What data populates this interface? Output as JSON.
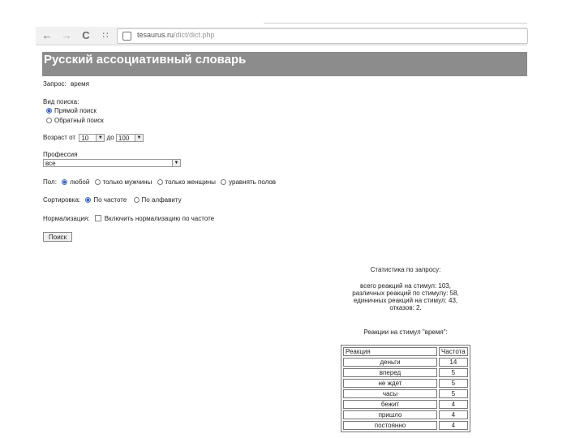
{
  "browser": {
    "url_host": "tesaurus.ru",
    "url_path": "/dict/dict.php",
    "icons": [
      "back-arrow-icon",
      "forward-arrow-icon",
      "reload-icon",
      "apps-icon",
      "page-info-icon"
    ]
  },
  "header": {
    "title": "Русский ассоциативный словарь"
  },
  "query": {
    "label": "Запрос:",
    "value": "время"
  },
  "search_type": {
    "label": "Вид поиска:",
    "options": [
      {
        "label": "Прямой поиск",
        "selected": true
      },
      {
        "label": "Обратный поиск",
        "selected": false
      }
    ]
  },
  "age": {
    "label_from": "Возраст от",
    "from_value": "10",
    "label_to": "до",
    "to_value": "100"
  },
  "profession": {
    "label": "Профессия",
    "value": "все"
  },
  "gender": {
    "label": "Пол:",
    "options": [
      {
        "label": "любой",
        "selected": true
      },
      {
        "label": "только мужчины",
        "selected": false
      },
      {
        "label": "только женщины",
        "selected": false
      },
      {
        "label": "уравнять полов",
        "selected": false
      }
    ]
  },
  "sorting": {
    "label": "Сортировка:",
    "options": [
      {
        "label": "По частоте",
        "selected": true
      },
      {
        "label": "По алфавиту",
        "selected": false
      }
    ]
  },
  "normalization": {
    "label": "Нормализация:",
    "checkbox_label": "Включить нормализацию по частоте",
    "checked": false
  },
  "search_button": "Поиск",
  "stats": {
    "title": "Статистика по запросу:",
    "lines": [
      "всего реакций на стимул: 103,",
      "различных реакций по стимулу: 58,",
      "единичных реакций на стимул: 43,",
      "отказов: 2."
    ]
  },
  "responses": {
    "title": "Реакции на стимул \"время\":",
    "columns": [
      "Реакция",
      "Частота"
    ],
    "rows": [
      [
        "деньги",
        "14"
      ],
      [
        "вперед",
        "5"
      ],
      [
        "не ждет",
        "5"
      ],
      [
        "часы",
        "5"
      ],
      [
        "бежит",
        "4"
      ],
      [
        "пришло",
        "4"
      ],
      [
        "постоянно",
        "4"
      ]
    ]
  }
}
